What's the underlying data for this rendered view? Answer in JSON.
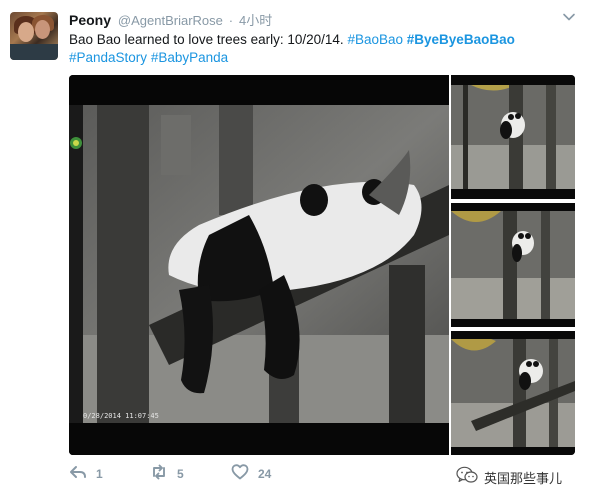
{
  "tweet": {
    "display_name": "Peony",
    "handle": "@AgentBriarRose",
    "separator": "·",
    "time": "4小时",
    "text_plain": "Bao Bao learned to love trees early: 10/20/14.",
    "hashtags": [
      "#BaoBao",
      "#ByeByeBaoBao",
      "#PandaStory",
      "#BabyPanda"
    ],
    "avatar_icon": "user-avatar-photo",
    "menu_icon": "chevron-down-icon"
  },
  "media": {
    "main_image": "panda-sleeping-on-tree-photo",
    "main_timestamp": "0/28/2014 11:07:45",
    "thumbnails": [
      "panda-on-tree-thumb-1",
      "panda-on-tree-thumb-2",
      "panda-on-tree-thumb-3"
    ]
  },
  "actions": {
    "reply_count": "1",
    "retweet_count": "5",
    "like_count": "24"
  },
  "watermark": {
    "text": "英国那些事儿",
    "icon": "wechat-icon"
  },
  "colors": {
    "link": "#1b95e0",
    "muted": "#8899a6",
    "text": "#14171a"
  }
}
